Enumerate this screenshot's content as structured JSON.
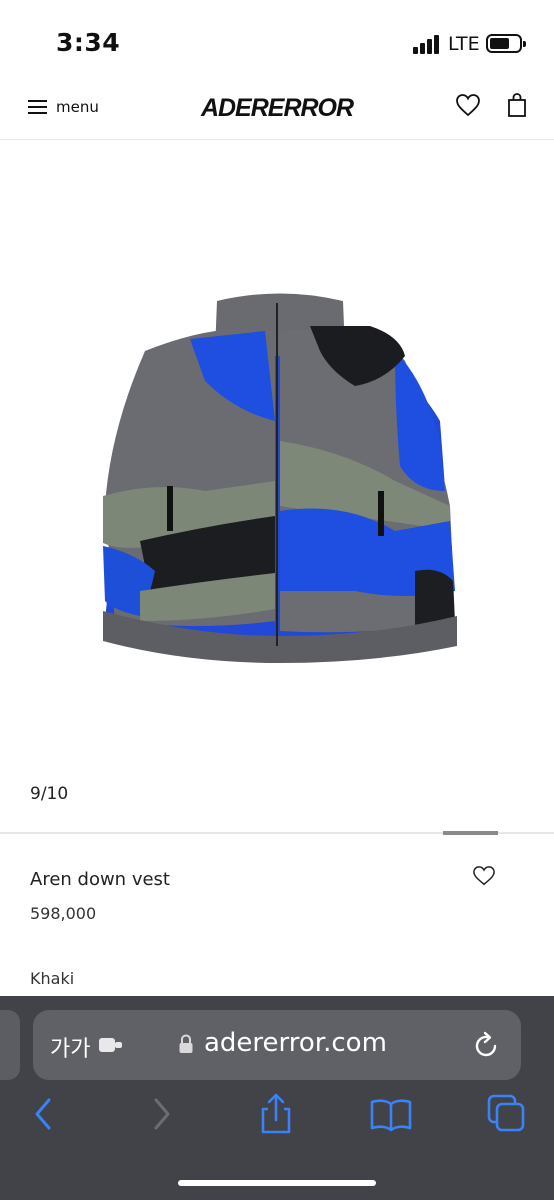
{
  "status_bar": {
    "time": "3:34",
    "network": "LTE"
  },
  "header": {
    "menu_label": "menu",
    "logo_text": "ADERERROR",
    "icons": [
      "hamburger-icon",
      "heart-icon",
      "shopping-bag-icon"
    ]
  },
  "gallery": {
    "image_counter": "9/10",
    "image_subject": "vest-product-photo"
  },
  "product": {
    "name": "Aren down vest",
    "price": "598,000",
    "color": "Khaki"
  },
  "browser": {
    "text_size_label": "가가",
    "url": "adererror.com",
    "toolbar_icons": [
      "back-icon",
      "forward-icon",
      "share-icon",
      "bookmarks-icon",
      "tabs-icon"
    ]
  },
  "colors": {
    "accent_blue": "#3b82f6",
    "bar_bg": "#414348",
    "urlbar_bg": "#5f6166"
  }
}
